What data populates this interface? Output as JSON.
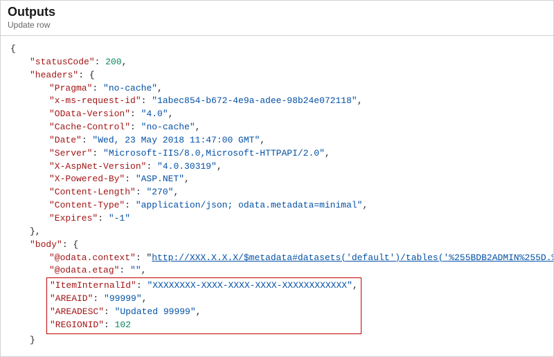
{
  "header": {
    "title": "Outputs",
    "subtitle": "Update row"
  },
  "json": {
    "statusCode_key": "\"statusCode\"",
    "statusCode_val": "200",
    "headers_key": "\"headers\"",
    "Pragma_key": "\"Pragma\"",
    "Pragma_val": "\"no-cache\"",
    "xms_key": "\"x-ms-request-id\"",
    "xms_val": "\"1abec854-b672-4e9a-adee-98b24e072118\"",
    "odatav_key": "\"OData-Version\"",
    "odatav_val": "\"4.0\"",
    "cache_key": "\"Cache-Control\"",
    "cache_val": "\"no-cache\"",
    "date_key": "\"Date\"",
    "date_val": "\"Wed, 23 May 2018 11:47:00 GMT\"",
    "server_key": "\"Server\"",
    "server_val": "\"Microsoft-IIS/8.0,Microsoft-HTTPAPI/2.0\"",
    "aspnet_key": "\"X-AspNet-Version\"",
    "aspnet_val": "\"4.0.30319\"",
    "powered_key": "\"X-Powered-By\"",
    "powered_val": "\"ASP.NET\"",
    "clen_key": "\"Content-Length\"",
    "clen_val": "\"270\"",
    "ctype_key": "\"Content-Type\"",
    "ctype_val": "\"application/json; odata.metadata=minimal\"",
    "expires_key": "\"Expires\"",
    "expires_val": "\"-1\"",
    "body_key": "\"body\"",
    "ctx_key": "\"@odata.context\"",
    "ctx_val": "http://XXX.X.X.X/$metadata#datasets('default')/tables('%255BDB2ADMIN%255D.%",
    "etag_key": "\"@odata.etag\"",
    "etag_val": "\"\"",
    "item_key": "\"ItemInternalId\"",
    "item_val": "\"XXXXXXXX-XXXX-XXXX-XXXX-XXXXXXXXXXXX\"",
    "areaid_key": "\"AREAID\"",
    "areaid_val": "\"99999\"",
    "areadesc_key": "\"AREADESC\"",
    "areadesc_val": "\"Updated 99999\"",
    "regionid_key": "\"REGIONID\"",
    "regionid_val": "102"
  }
}
